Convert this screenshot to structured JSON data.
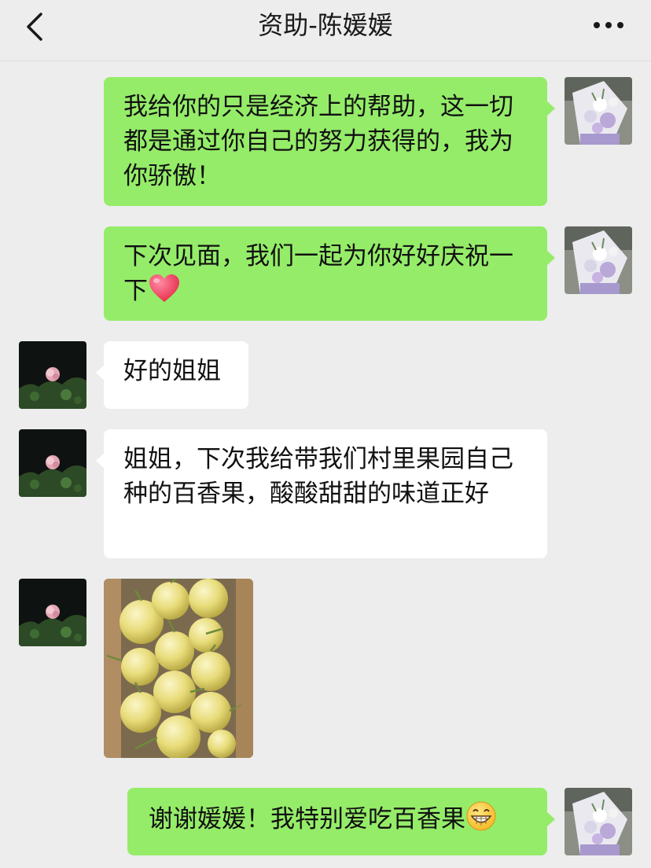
{
  "header": {
    "title": "资助-陈媛媛"
  },
  "icons": {
    "back": "chevron-left-icon",
    "more": "more-dots-icon",
    "heart": "red-heart-emoji",
    "grin": "grinning-emoji"
  },
  "messages": [
    {
      "sender": "me",
      "text": "我给你的只是经济上的帮助，这一切都是通过你自己的努力获得的，我为你骄傲！"
    },
    {
      "sender": "me",
      "text": "下次见面，我们一起为你好好庆祝一下"
    },
    {
      "sender": "other",
      "text": "好的姐姐"
    },
    {
      "sender": "other",
      "text": "姐姐，下次我给带我们村里果园自己种的百香果，酸酸甜甜的味道正好"
    },
    {
      "sender": "other",
      "type": "image",
      "content": "passion fruits in a cardboard box"
    },
    {
      "sender": "me",
      "text": "谢谢媛媛！我特别爱吃百香果"
    }
  ],
  "colors": {
    "background": "#ededed",
    "my_bubble": "#95ec69",
    "other_bubble": "#ffffff"
  }
}
